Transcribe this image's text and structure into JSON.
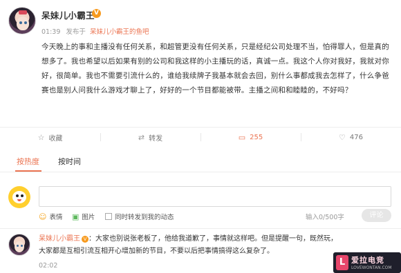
{
  "post": {
    "author": "呆妹儿小霸王",
    "verified_badge": "V",
    "time": "01:39",
    "from_label": "发布于",
    "source": "呆妹儿小霸王的鱼吧",
    "content": "今天晚上的事和主播没有任何关系，和超管更没有任何关系，只是经纪公司处理不当，怕得罪人，但是真的想多了。我也希望以后如果有别的公司和我这样的小主播玩的话，真诚一点。我这个人你对我好，我就对你好，很简单。我也不需要引流什么的，谁给我续牌子我基本就会去回，别什么事都成我去怎样了，什么争爸赛也是别人问我什么游戏才聊上了，好好的一个节目都能被带。主播之间和和睦睦的，不好吗？"
  },
  "actions": {
    "collect": {
      "icon": "star-icon",
      "label": "收藏"
    },
    "repost": {
      "icon": "repost-icon",
      "label": "转发"
    },
    "comment": {
      "icon": "comment-icon",
      "label": "255"
    },
    "like": {
      "icon": "thumbs-up-icon",
      "label": "476"
    }
  },
  "tabs": [
    {
      "label": "按热度",
      "active": true
    },
    {
      "label": "按时间",
      "active": false
    }
  ],
  "composer": {
    "input_value": "",
    "emoji_label": "表情",
    "image_label": "图片",
    "repost_check_label": "同时转发到我的动态",
    "counter": "0/500字",
    "counter_prefix": "输入",
    "submit_label": "评论"
  },
  "comment": {
    "author": "呆妹儿小霸王",
    "badge": "V",
    "text": "：大家也别说张老板了，他给我道歉了，事情就这样吧。但是提醒一句，既然玩，大家都是互相引流互相开心增加新的节目，不要以后把事情搞得这么复杂了。",
    "time": "02:02"
  },
  "watermark": {
    "logo_letter": "L",
    "title": "爱拉电竞",
    "url": "LOVEWONTAN.COM"
  },
  "colors": {
    "accent": "#eb7350",
    "badge": "#f79a1e",
    "border": "#eeeeee",
    "muted_text": "#999999"
  }
}
